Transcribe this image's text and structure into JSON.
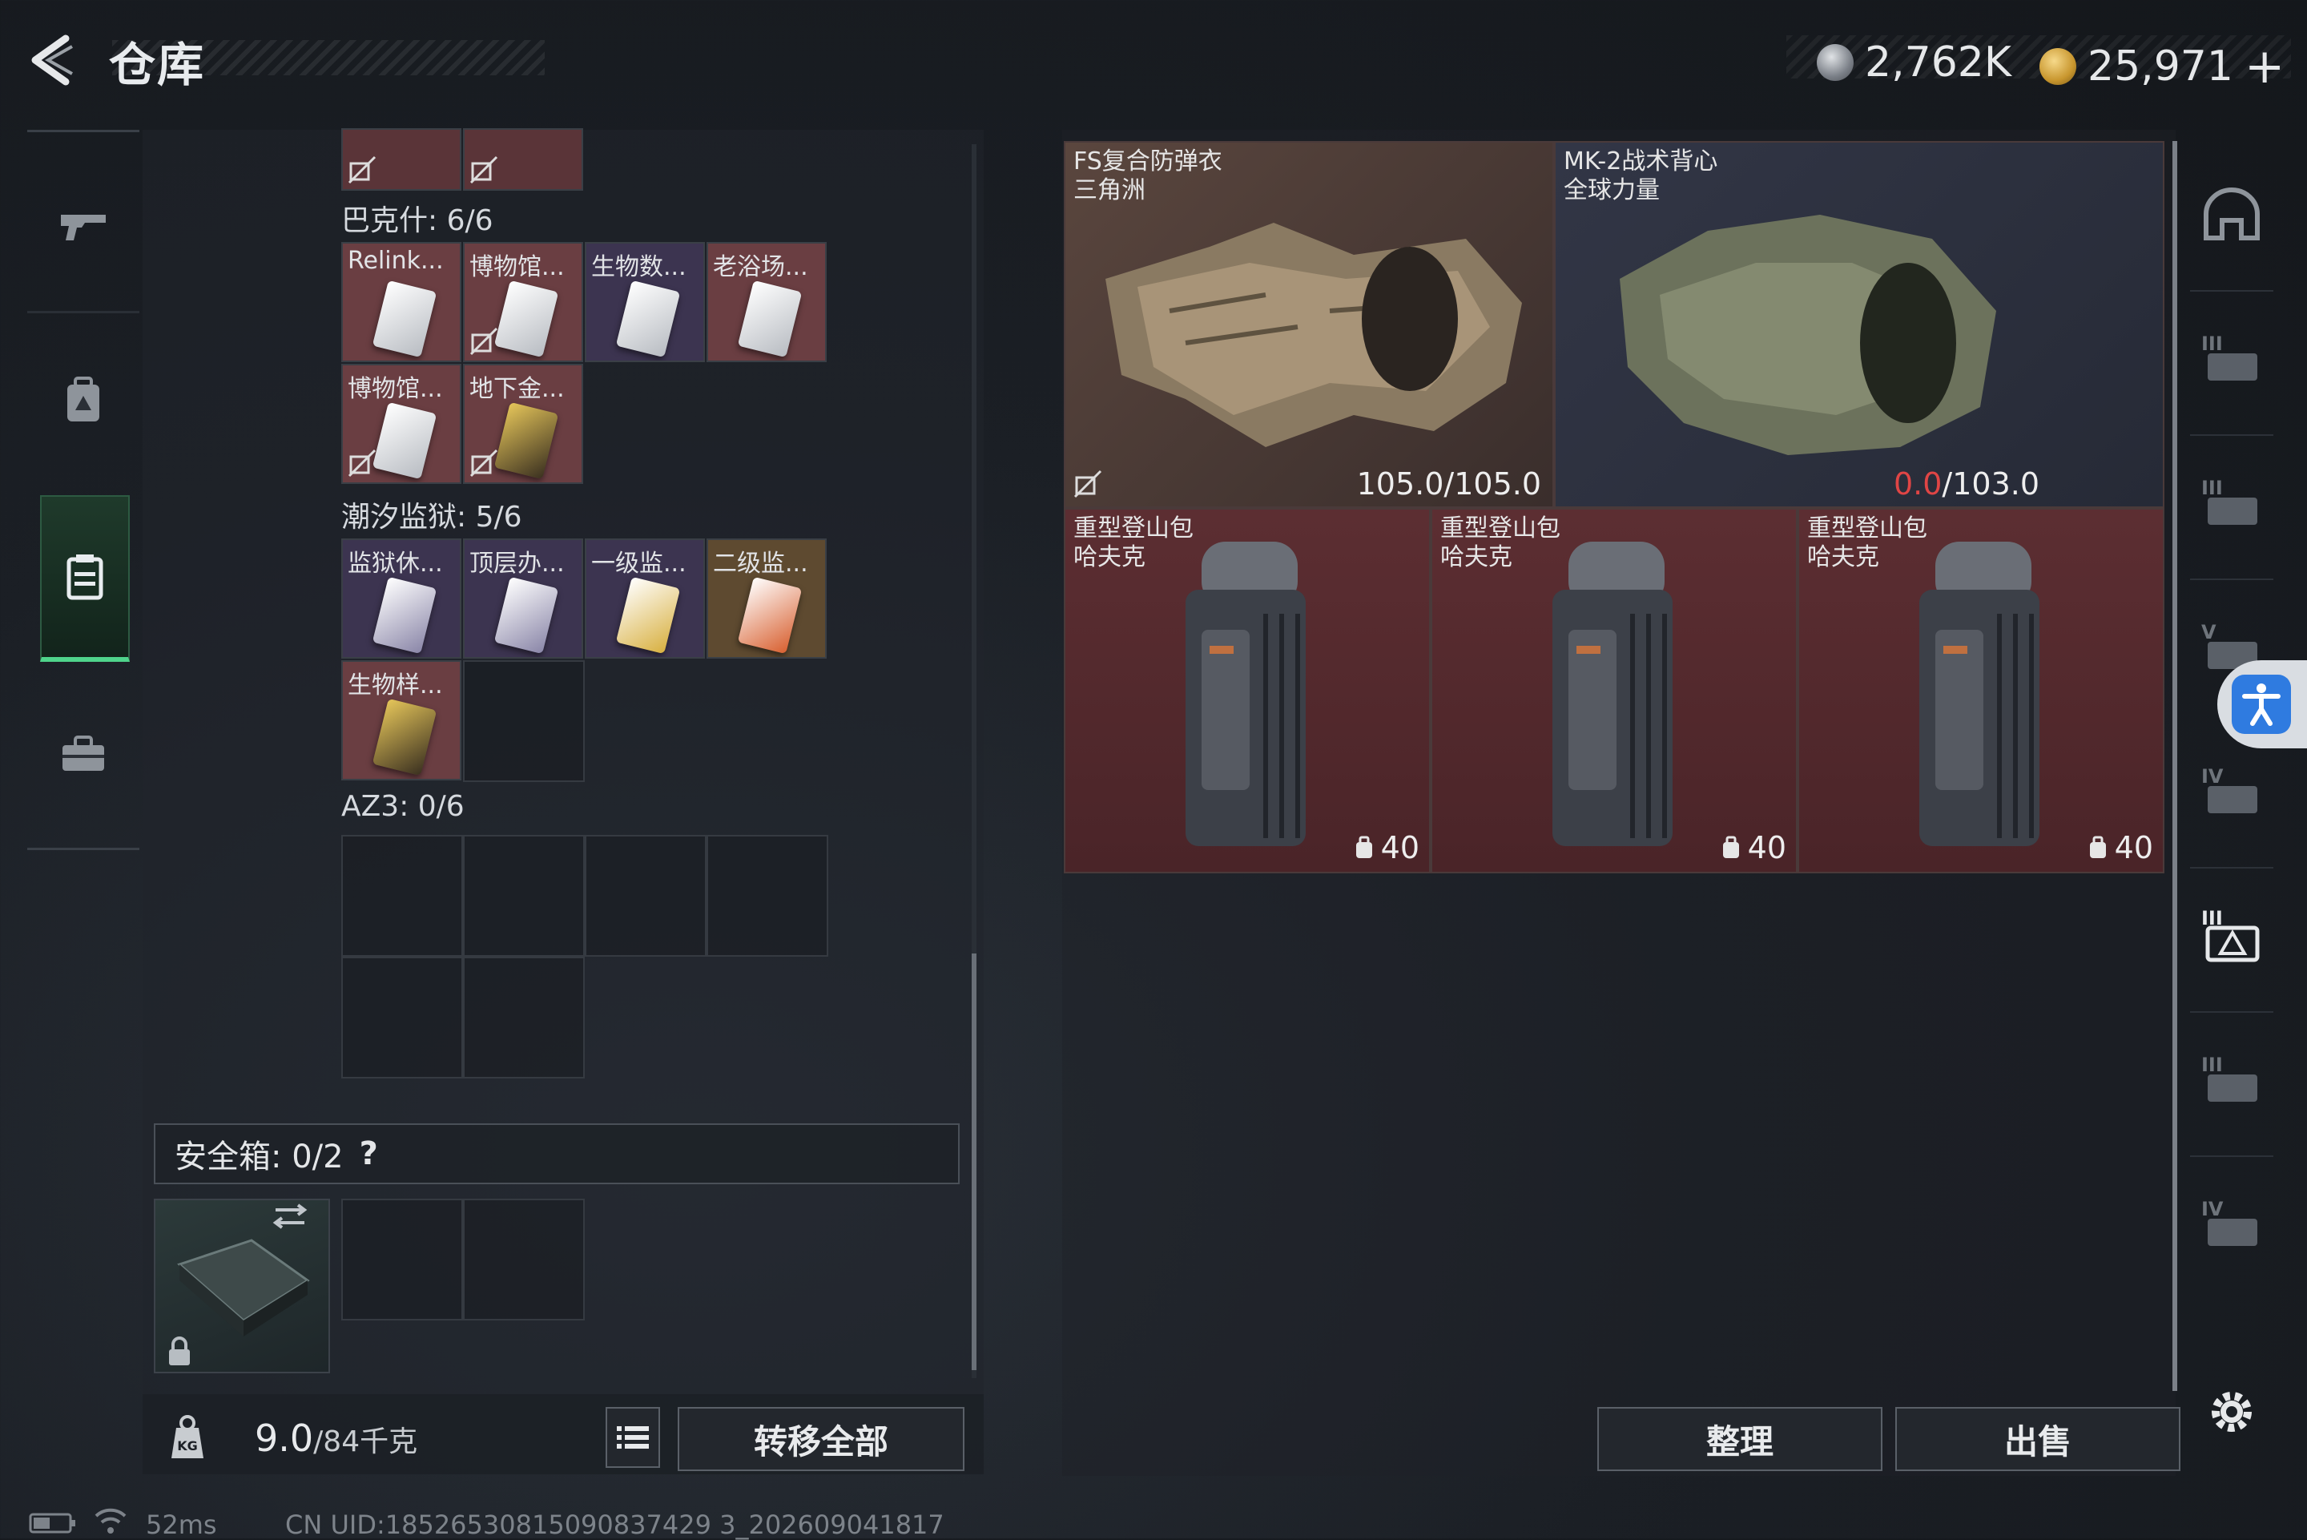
{
  "header": {
    "title": "仓库",
    "currency": [
      {
        "icon": "silver-coin-icon",
        "value": "2,762K"
      },
      {
        "icon": "gold-coin-icon",
        "value": "25,971"
      }
    ],
    "add_label": "+"
  },
  "left_nav": {
    "items": [
      {
        "icon": "gun-icon",
        "active": false
      },
      {
        "icon": "backpack-icon",
        "active": false
      },
      {
        "icon": "storage-case-icon",
        "active": true
      },
      {
        "icon": "toolbox-icon",
        "active": false
      }
    ]
  },
  "storage": {
    "sections": [
      {
        "label": "巴克什: 6/6",
        "items": [
          {
            "label": "Relink...",
            "color": "#7a4a4a"
          },
          {
            "label": "博物馆...",
            "color": "#7a4a4a",
            "locked": true
          },
          {
            "label": "生物数...",
            "color": "#3e3450"
          },
          {
            "label": "老浴场...",
            "color": "#7a4a4a"
          },
          {
            "label": "博物馆...",
            "color": "#7a4a4a",
            "locked": true
          },
          {
            "label": "地下金...",
            "color": "#7a4a4a",
            "locked": true
          }
        ]
      },
      {
        "label": "潮汐监狱: 5/6",
        "items": [
          {
            "label": "监狱休...",
            "color": "#3e3450"
          },
          {
            "label": "顶层办...",
            "color": "#3e3450"
          },
          {
            "label": "一级监...",
            "color": "#3e3450"
          },
          {
            "label": "二级监...",
            "color": "#6a5030"
          },
          {
            "label": "生物样...",
            "color": "#7a4a4a"
          }
        ]
      },
      {
        "label": "AZ3: 0/6",
        "items": []
      }
    ],
    "safe_box": {
      "label": "安全箱: 0/2",
      "help": "?"
    },
    "weight_value": "9.0",
    "weight_total": "/84千克",
    "transfer_all": "转移全部"
  },
  "equipment": {
    "armor": [
      {
        "name": "FS复合防弹衣",
        "sub": "三角洲",
        "durability_current": "105.0",
        "durability_max": "/105.0",
        "low": false,
        "bg": "#4a3a34"
      },
      {
        "name": "MK-2战术背心",
        "sub": "全球力量",
        "durability_current": "0.0",
        "durability_max": "/103.0",
        "low": true,
        "bg": "#2c3040"
      }
    ],
    "backpacks": [
      {
        "name": "重型登山包",
        "sub": "哈夫克",
        "capacity": "40"
      },
      {
        "name": "重型登山包",
        "sub": "哈夫克",
        "capacity": "40"
      },
      {
        "name": "重型登山包",
        "sub": "哈夫克",
        "capacity": "40"
      }
    ],
    "sort_label": "整理",
    "sell_label": "出售"
  },
  "status_bar": {
    "ping": "52ms",
    "uid": "CN UID:18526530815090837429 3_202609041817"
  },
  "colors": {
    "accent_green": "#4fd48b",
    "low_durability": "#e04545",
    "slot_red": "#5a2c30"
  }
}
